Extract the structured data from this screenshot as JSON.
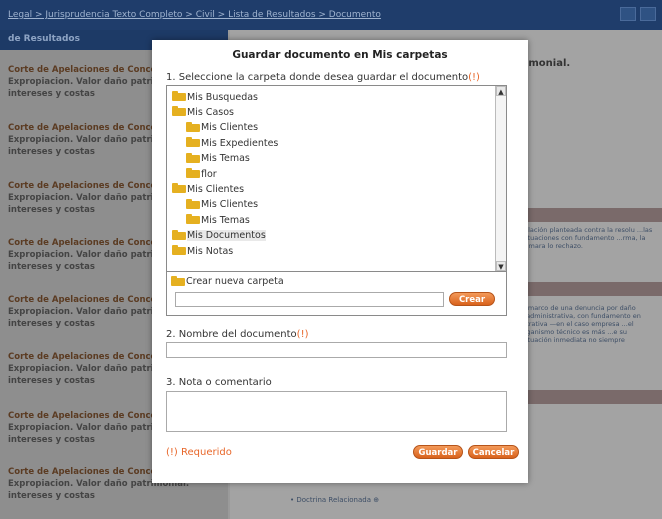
{
  "background": {
    "breadcrumb": "Legal > Jurisprudencia Texto Completo > Civil > Lista de Resultados > Documento",
    "results_header": "de Resultados",
    "results": [
      {
        "line1": "Corte de Apelaciones de Conce",
        "line2": "Expropiacion. Valor daño patri",
        "line3": "intereses y costas"
      },
      {
        "line1": "Corte de Apelaciones de Conce",
        "line2": "Expropiacion. Valor daño patri",
        "line3": "intereses y costas"
      },
      {
        "line1": "Corte de Apelaciones de Conce",
        "line2": "Expropiacion. Valor daño patri",
        "line3": "intereses y costas"
      },
      {
        "line1": "Corte de Apelaciones de Conce",
        "line2": "Expropiacion. Valor daño patri",
        "line3": "intereses y costas"
      },
      {
        "line1": "Corte de Apelaciones de Conce",
        "line2": "Expropiacion. Valor daño patri",
        "line3": "intereses y costas"
      },
      {
        "line1": "Corte de Apelaciones de Conce",
        "line2": "Expropiacion. Valor daño patri",
        "line3": "intereses y costas"
      },
      {
        "line1": "Corte de Apelaciones de Conce",
        "line2": "Expropiacion. Valor daño patri",
        "line3": "intereses y costas"
      },
      {
        "line1": "Corte de Apelaciones de Conce",
        "line2": "Expropiacion. Valor daño patrimonial.",
        "line3": "intereses y costas"
      }
    ],
    "doc_title_fragment": "rimonial.",
    "doc_text_1": "pelación planteada contra la resolu ...las actuaciones con fundamento ...rma, la Cámara lo rechazo.",
    "doc_text_2": "el marco de una denuncia por daño ...administrativa, con fundamento en ...trativa —en el caso empresa ...el organismo técnico es más ...e su actuación inmediata no siempre",
    "related_link": "• Doctrina Relacionada ⊕"
  },
  "modal": {
    "title": "Guardar documento en Mis carpetas",
    "step1_label": "1. Seleccione la carpeta donde desea guardar el documento",
    "required_mark": "(!)",
    "folders": [
      {
        "label": "Mis Busquedas",
        "depth": 0
      },
      {
        "label": "Mis Casos",
        "depth": 0
      },
      {
        "label": "Mis Clientes",
        "depth": 1
      },
      {
        "label": "Mis Expedientes",
        "depth": 1
      },
      {
        "label": "Mis Temas",
        "depth": 1
      },
      {
        "label": "flor",
        "depth": 1
      },
      {
        "label": "Mis Clientes",
        "depth": 0
      },
      {
        "label": "Mis Clientes",
        "depth": 1
      },
      {
        "label": "Mis Temas",
        "depth": 1
      },
      {
        "label": "Mis Documentos",
        "depth": 0,
        "selected": true
      },
      {
        "label": "Mis Notas",
        "depth": 0
      }
    ],
    "create_folder_label": "Crear nueva carpeta",
    "create_button": "Crear",
    "step2_label": "2. Nombre del documento",
    "step3_label": "3. Nota o comentario",
    "required_legend": "(!) Requerido",
    "save_button": "Guardar",
    "cancel_button": "Cancelar"
  },
  "colors": {
    "accent": "#e8672a",
    "folder": "#e5b020",
    "header_bar": "#1f3d6b"
  }
}
